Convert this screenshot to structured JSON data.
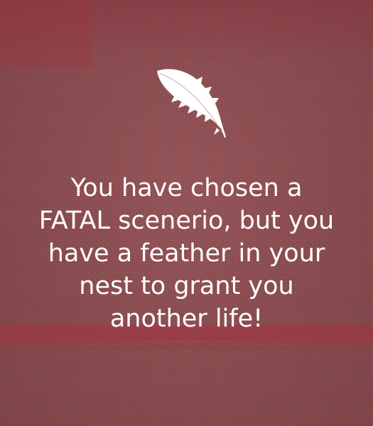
{
  "feather": {
    "icon": "feather-icon"
  },
  "message": "You have chosen a\nFATAL scenerio, but you\nhave a feather in your\nnest to grant you\nanother life!",
  "colors": {
    "background": "#8f4a4e",
    "accent_band": "#aa2d41",
    "text": "#ffffff"
  }
}
